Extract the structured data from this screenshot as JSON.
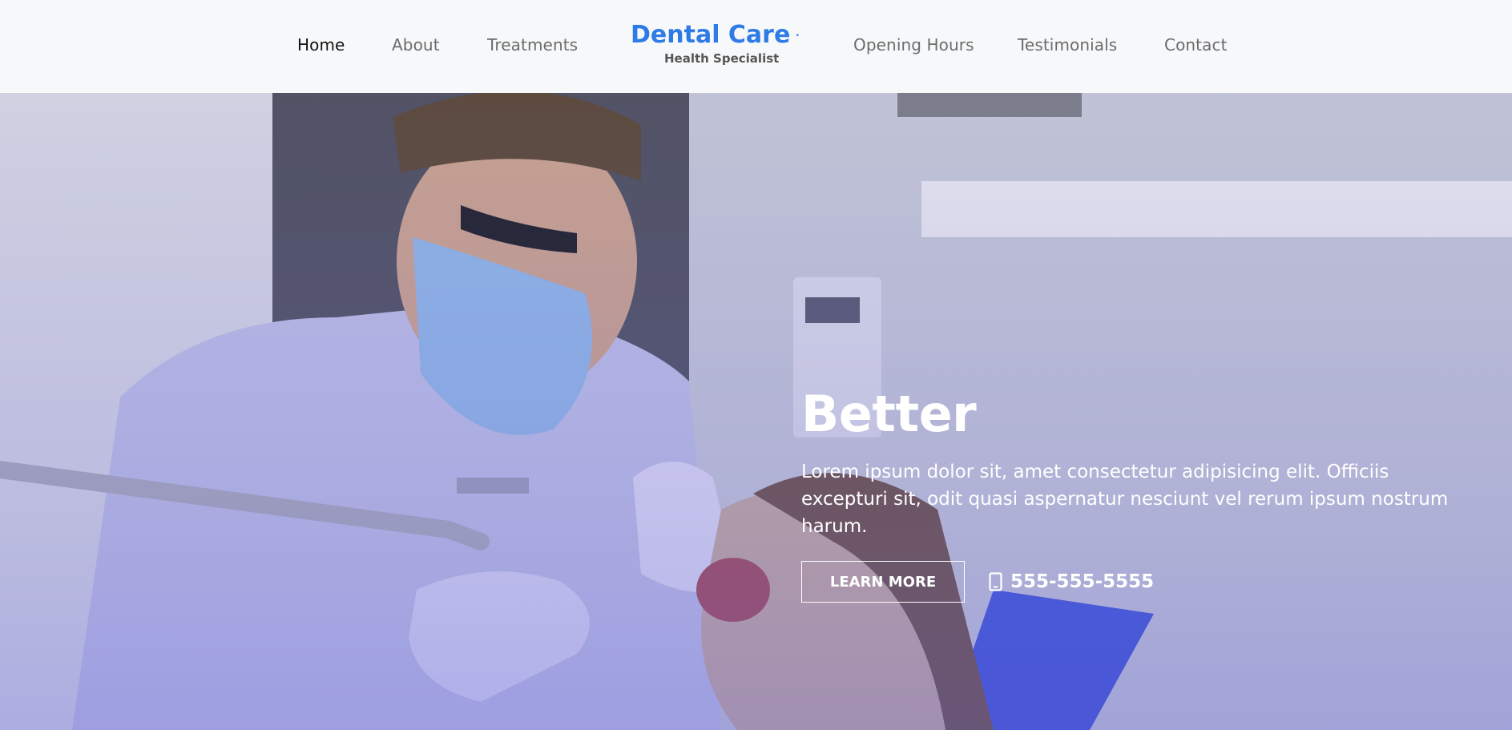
{
  "nav": {
    "items": [
      {
        "label": "Home",
        "active": true
      },
      {
        "label": "About"
      },
      {
        "label": "Treatments"
      },
      {
        "label": "Opening Hours"
      },
      {
        "label": "Testimonials"
      },
      {
        "label": "Contact"
      }
    ]
  },
  "brand": {
    "title": "Dental Care",
    "subtitle": "Health Specialist",
    "icon": "tooth-icon",
    "color": "#2f7be6"
  },
  "hero": {
    "title": "Better",
    "text": "Lorem ipsum dolor sit, amet consectetur adipisicing elit. Officiis excepturi sit, odit quasi aspernatur nesciunt vel rerum ipsum nostrum harum.",
    "button_label": "LEARN MORE",
    "phone": "555-555-5555",
    "phone_icon": "mobile-phone-icon"
  }
}
